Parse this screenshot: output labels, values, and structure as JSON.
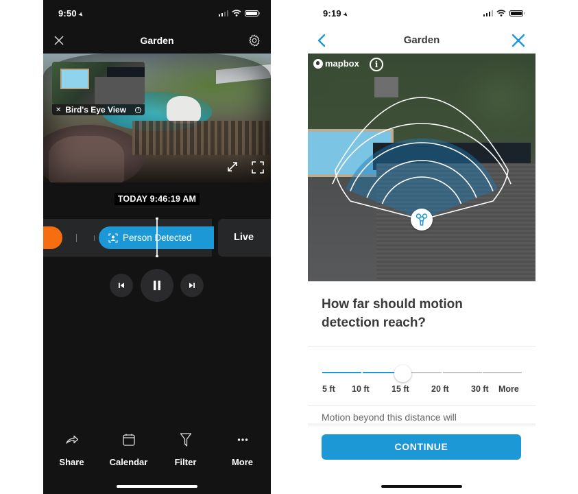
{
  "left_screen": {
    "status_bar": {
      "time": "9:50",
      "location_icon": "location-arrow-icon",
      "signal_bars": 4,
      "signal_active": 2
    },
    "header": {
      "title": "Garden",
      "close_icon": "close-icon",
      "settings_icon": "gear-icon"
    },
    "video": {
      "pip_label": "Bird's Eye View",
      "pip_close_icon": "close-icon",
      "pip_info_icon": "info-icon",
      "expand_icon": "expand-arrows-icon",
      "fullscreen_icon": "fullscreen-icon"
    },
    "timestamp": "TODAY 9:46:19 AM",
    "timeline": {
      "event_label": "Person Detected",
      "event_icon": "person-icon",
      "live_label": "Live",
      "colors": {
        "motion": "#f76e10",
        "person": "#1c98d6"
      }
    },
    "playback": {
      "prev_icon": "skip-previous-icon",
      "pause_icon": "pause-icon",
      "next_icon": "skip-next-icon"
    },
    "toolbar": [
      {
        "label": "Share",
        "icon": "share-icon"
      },
      {
        "label": "Calendar",
        "icon": "calendar-icon"
      },
      {
        "label": "Filter",
        "icon": "filter-icon"
      },
      {
        "label": "More",
        "icon": "more-dots-icon"
      }
    ]
  },
  "right_screen": {
    "status_bar": {
      "time": "9:19",
      "location_icon": "location-arrow-icon",
      "signal_bars": 4,
      "signal_active": 3
    },
    "header": {
      "title": "Garden",
      "back_icon": "chevron-left-icon",
      "close_icon": "close-icon"
    },
    "map": {
      "attribution": "mapbox",
      "info_icon": "info-icon",
      "camera_icon": "camera-device-icon",
      "zone_rings": 5,
      "active_rings": 3
    },
    "question": "How far should motion detection reach?",
    "slider": {
      "options": [
        "5 ft",
        "10 ft",
        "15 ft",
        "20 ft",
        "30 ft",
        "More"
      ],
      "selected_index": 2,
      "selected_value": "15 ft",
      "active_color": "#1c98d6",
      "inactive_color": "#c4c4c4"
    },
    "description": "Motion beyond this distance will",
    "continue_label": "CONTINUE",
    "accent_color": "#1c98d6"
  }
}
